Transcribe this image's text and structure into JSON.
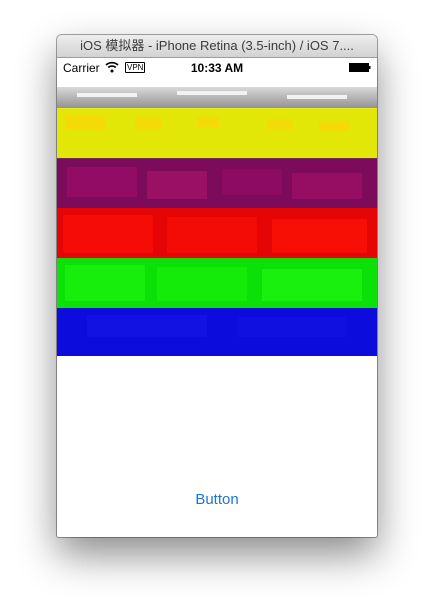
{
  "window": {
    "title": "iOS 模拟器 - iPhone Retina (3.5-inch) / iOS 7...."
  },
  "status_bar": {
    "carrier": "Carrier",
    "vpn": "VPN",
    "time": "10:33 AM"
  },
  "overlay_bands": [
    {
      "color": "#ffff00"
    },
    {
      "color": "#800080"
    },
    {
      "color": "#ff0000"
    },
    {
      "color": "#00ff00"
    },
    {
      "color": "#0000ff"
    }
  ],
  "main": {
    "button_label": "Button"
  },
  "colors": {
    "button_text": "#1a76d2"
  }
}
